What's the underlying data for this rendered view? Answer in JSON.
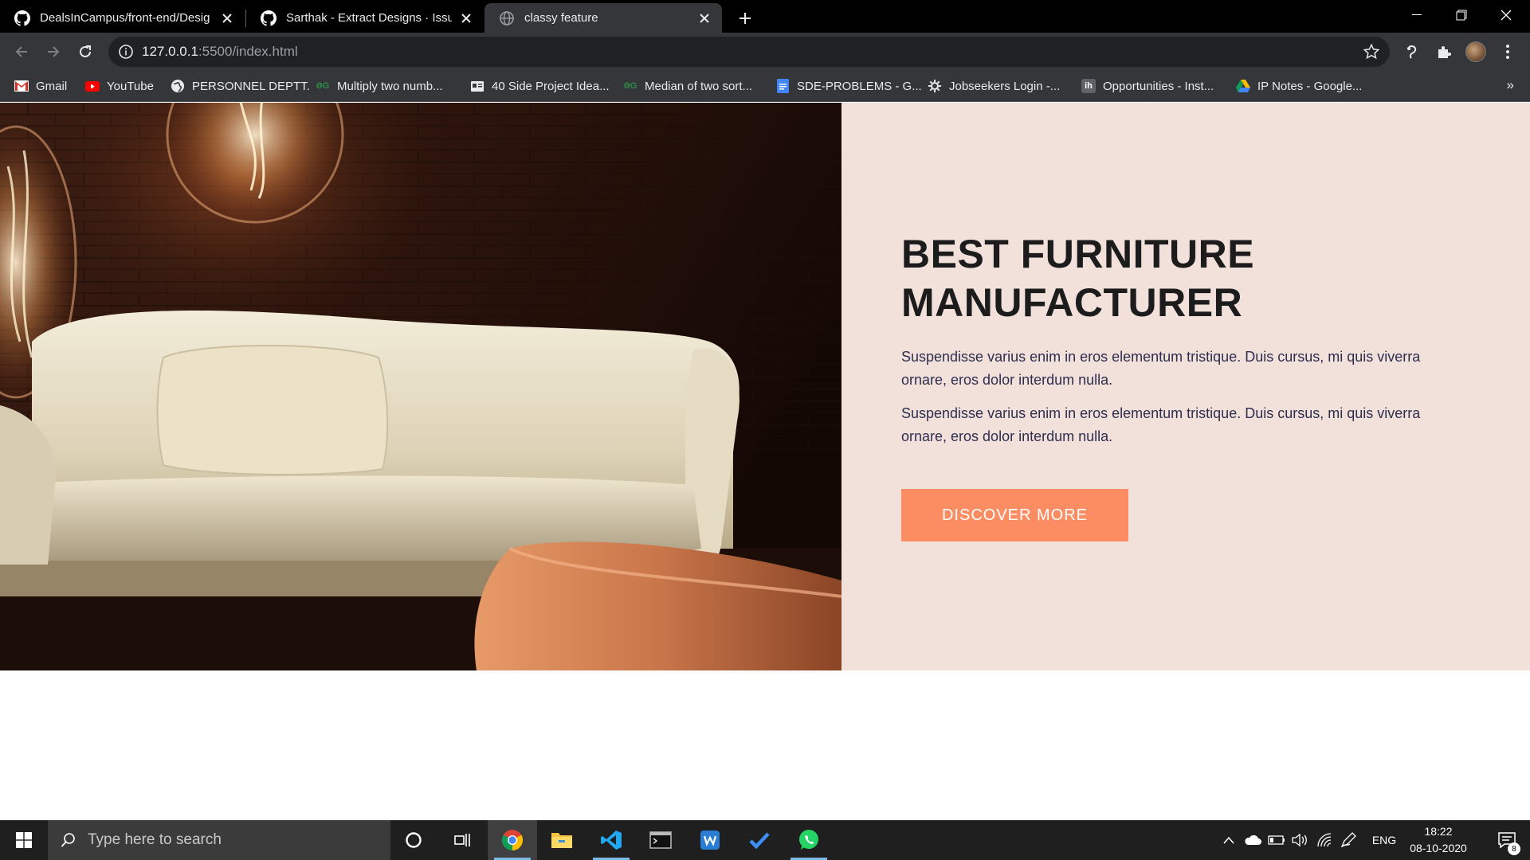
{
  "browser": {
    "tabs": [
      {
        "title": "DealsInCampus/front-end/Desig",
        "icon": "github-icon"
      },
      {
        "title": "Sarthak - Extract Designs · Issue #",
        "icon": "github-icon"
      },
      {
        "title": "classy feature",
        "icon": "globe-icon",
        "active": true
      }
    ],
    "url_host": "127.0.0.1",
    "url_path": ":5500/index.html",
    "bookmarks": [
      {
        "label": "Gmail",
        "icon": "gmail-icon"
      },
      {
        "label": "YouTube",
        "icon": "youtube-icon"
      },
      {
        "label": "PERSONNEL DEPTT.",
        "icon": "globe-icon"
      },
      {
        "label": "Multiply two numb...",
        "icon": "gfg-icon"
      },
      {
        "label": "40 Side Project Idea...",
        "icon": "card-icon"
      },
      {
        "label": "Median of two sort...",
        "icon": "gfg-icon"
      },
      {
        "label": "SDE-PROBLEMS - G...",
        "icon": "docs-icon"
      },
      {
        "label": "Jobseekers Login -...",
        "icon": "gear-icon"
      },
      {
        "label": "Opportunities - Inst...",
        "icon": "ih-icon"
      },
      {
        "label": "IP Notes - Google...",
        "icon": "drive-icon"
      }
    ],
    "more": "»"
  },
  "hero": {
    "title_line1": "BEST FURNITURE",
    "title_line2": "MANUFACTURER",
    "paragraph1": "Suspendisse varius enim in eros elementum tristique. Duis cursus, mi quis viverra ornare, eros dolor interdum nulla.",
    "paragraph2": "Suspendisse varius enim in eros elementum tristique. Duis cursus, mi quis viverra ornare, eros dolor interdum nulla.",
    "cta_label": "DISCOVER MORE",
    "panel_color": "#f2e0db",
    "cta_color": "#fc8d63"
  },
  "taskbar": {
    "search_placeholder": "Type here to search",
    "language": "ENG",
    "time": "18:22",
    "date": "08-10-2020",
    "notification_count": "8",
    "pinned": [
      "cortana-icon",
      "task-view-icon",
      "chrome-icon",
      "file-explorer-icon",
      "vscode-icon",
      "terminal-icon",
      "writer-icon",
      "todo-icon",
      "whatsapp-icon"
    ]
  }
}
